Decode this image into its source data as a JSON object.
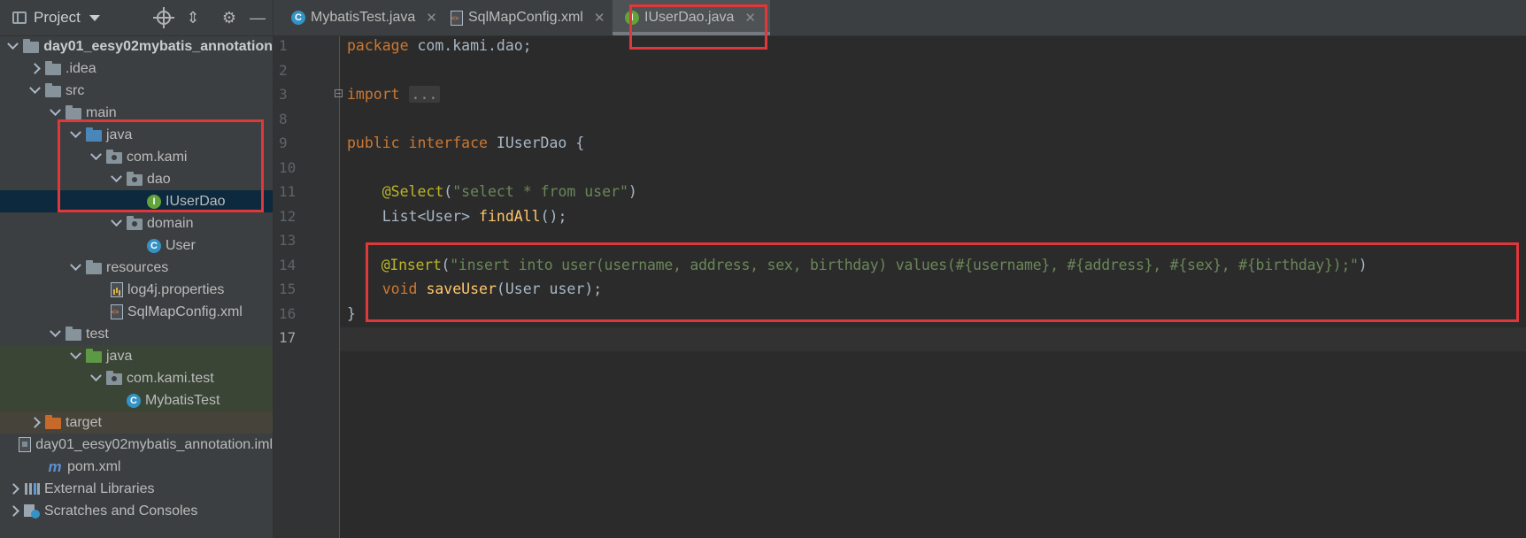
{
  "project_panel": {
    "title": "Project",
    "tree": [
      {
        "label": "day01_eesy02mybatis_annotation"
      },
      {
        "label": ".idea"
      },
      {
        "label": "src"
      },
      {
        "label": "main"
      },
      {
        "label": "java"
      },
      {
        "label": "com.kami"
      },
      {
        "label": "dao"
      },
      {
        "label": "IUserDao"
      },
      {
        "label": "domain"
      },
      {
        "label": "User"
      },
      {
        "label": "resources"
      },
      {
        "label": "log4j.properties"
      },
      {
        "label": "SqlMapConfig.xml"
      },
      {
        "label": "test"
      },
      {
        "label": "java"
      },
      {
        "label": "com.kami.test"
      },
      {
        "label": "MybatisTest"
      },
      {
        "label": "target"
      },
      {
        "label": "day01_eesy02mybatis_annotation.iml"
      },
      {
        "label": "pom.xml"
      },
      {
        "label": "External Libraries"
      },
      {
        "label": "Scratches and Consoles"
      }
    ]
  },
  "tabs": [
    {
      "label": "MybatisTest.java",
      "icon": "class-icon"
    },
    {
      "label": "SqlMapConfig.xml",
      "icon": "xml-file-icon"
    },
    {
      "label": "IUserDao.java",
      "icon": "interface-icon",
      "active": true
    }
  ],
  "editor": {
    "line_numbers": [
      "1",
      "2",
      "3",
      "8",
      "9",
      "10",
      "11",
      "12",
      "13",
      "14",
      "15",
      "16",
      "17"
    ],
    "current_line": "17",
    "code": {
      "l1_kw": "package",
      "l1_rest": " com.kami.dao;",
      "l3_kw": "import",
      "l3_fold": "...",
      "l9_kw1": "public",
      "l9_kw2": "interface",
      "l9_rest": " IUserDao {",
      "l11_an": "@Select",
      "l11_p1": "(",
      "l11_str": "\"select * from user\"",
      "l11_p2": ")",
      "l12_type": "List<User> ",
      "l12_fn": "findAll",
      "l12_rest": "();",
      "l14_an": "@Insert",
      "l14_p1": "(",
      "l14_str": "\"insert into user(username, address, sex, birthday) values(#{username}, #{address}, #{sex}, #{birthday});\"",
      "l14_p2": ")",
      "l15_kw": "void",
      "l15_fn": "saveUser",
      "l15_rest": "(User user);",
      "l16": "}"
    }
  },
  "colors": {
    "keyword": "#cc7832",
    "annotation": "#bbb529",
    "string": "#6a8759",
    "method": "#ffc66d",
    "highlight_box": "#e0373a"
  }
}
